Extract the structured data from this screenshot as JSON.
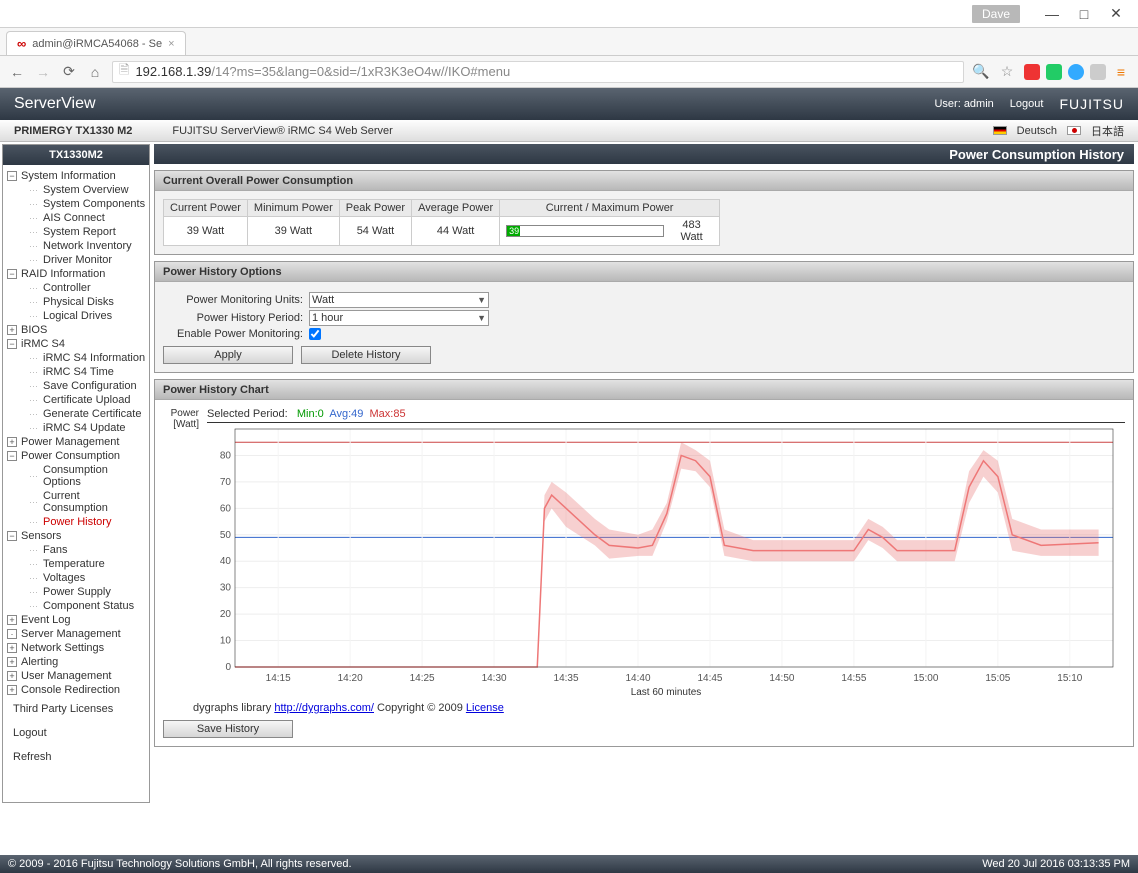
{
  "window": {
    "user_badge": "Dave"
  },
  "browser": {
    "tab_title": "admin@iRMCA54068 - Se",
    "url_host": "192.168.1.39",
    "url_path": "/14?ms=35&lang=0&sid=/1xR3K3eO4w//IKO#menu"
  },
  "header": {
    "title": "ServerView",
    "user_label": "User:",
    "user": "admin",
    "logout": "Logout",
    "logo": "FUJITSU"
  },
  "subheader": {
    "product": "PRIMERGY TX1330 M2",
    "server_line": "FUJITSU ServerView® iRMC S4 Web Server",
    "lang_de": "Deutsch",
    "lang_jp": "日本語"
  },
  "sidebar": {
    "host": "TX1330M2",
    "items": [
      {
        "label": "System Information",
        "top": true,
        "open": true
      },
      {
        "label": "System Overview",
        "child": true
      },
      {
        "label": "System Components",
        "child": true
      },
      {
        "label": "AIS Connect",
        "child": true
      },
      {
        "label": "System Report",
        "child": true
      },
      {
        "label": "Network Inventory",
        "child": true
      },
      {
        "label": "Driver Monitor",
        "child": true
      },
      {
        "label": "RAID Information",
        "top": true,
        "open": true
      },
      {
        "label": "Controller",
        "child": true
      },
      {
        "label": "Physical Disks",
        "child": true
      },
      {
        "label": "Logical Drives",
        "child": true
      },
      {
        "label": "BIOS",
        "top": true,
        "closed": true
      },
      {
        "label": "iRMC S4",
        "top": true,
        "open": true
      },
      {
        "label": "iRMC S4 Information",
        "child": true
      },
      {
        "label": "iRMC S4 Time",
        "child": true
      },
      {
        "label": "Save Configuration",
        "child": true
      },
      {
        "label": "Certificate Upload",
        "child": true
      },
      {
        "label": "Generate Certificate",
        "child": true
      },
      {
        "label": "iRMC S4 Update",
        "child": true
      },
      {
        "label": "Power Management",
        "top": true,
        "closed": true
      },
      {
        "label": "Power Consumption",
        "top": true,
        "open": true
      },
      {
        "label": "Consumption Options",
        "child": true
      },
      {
        "label": "Current Consumption",
        "child": true
      },
      {
        "label": "Power History",
        "child": true,
        "active": true
      },
      {
        "label": "Sensors",
        "top": true,
        "open": true
      },
      {
        "label": "Fans",
        "child": true
      },
      {
        "label": "Temperature",
        "child": true
      },
      {
        "label": "Voltages",
        "child": true
      },
      {
        "label": "Power Supply",
        "child": true
      },
      {
        "label": "Component Status",
        "child": true
      },
      {
        "label": "Event Log",
        "top": true,
        "closed": true
      },
      {
        "label": "Server Management",
        "top": true,
        "leaf": true
      },
      {
        "label": "Network Settings",
        "top": true,
        "closed": true
      },
      {
        "label": "Alerting",
        "top": true,
        "closed": true
      },
      {
        "label": "User Management",
        "top": true,
        "closed": true
      },
      {
        "label": "Console Redirection",
        "top": true,
        "closed": true
      }
    ],
    "footer": [
      "Third Party Licenses",
      "Logout",
      "Refresh"
    ]
  },
  "page": {
    "title": "Power Consumption History"
  },
  "panel1": {
    "title": "Current Overall Power Consumption",
    "cols": [
      "Current Power",
      "Minimum Power",
      "Peak Power",
      "Average Power",
      "Current / Maximum Power"
    ],
    "vals": [
      "39 Watt",
      "39 Watt",
      "54 Watt",
      "44 Watt"
    ],
    "bar_val": "39",
    "bar_max": "483 Watt"
  },
  "panel2": {
    "title": "Power History Options",
    "units_label": "Power Monitoring Units:",
    "units_val": "Watt",
    "period_label": "Power History Period:",
    "period_val": "1 hour",
    "enable_label": "Enable Power Monitoring:",
    "enable_checked": true,
    "apply": "Apply",
    "delete": "Delete History"
  },
  "panel3": {
    "title": "Power History Chart",
    "y_label": "Power [Watt]",
    "sel_period_label": "Selected Period:",
    "min": "Min:0",
    "avg": "Avg:49",
    "max": "Max:85",
    "x_label": "Last 60 minutes",
    "credits_pre": "dygraphs library ",
    "credits_link": "http://dygraphs.com/",
    "credits_mid": " Copyright © 2009 ",
    "credits_license": "License",
    "save": "Save History"
  },
  "chart_data": {
    "type": "line",
    "title": "Power [Watt]",
    "ylabel": "Power [Watt]",
    "xlabel": "Last 60 minutes",
    "ylim": [
      0,
      90
    ],
    "x_ticks": [
      "14:15",
      "14:20",
      "14:25",
      "14:30",
      "14:35",
      "14:40",
      "14:45",
      "14:50",
      "14:55",
      "15:00",
      "15:05",
      "15:10"
    ],
    "series": [
      {
        "name": "Power",
        "color": "#e77",
        "x": [
          "14:12",
          "14:33",
          "14:33.5",
          "14:34",
          "14:35",
          "14:37",
          "14:38",
          "14:40",
          "14:41",
          "14:42",
          "14:43",
          "14:44",
          "14:45",
          "14:46",
          "14:48",
          "14:55",
          "14:56",
          "14:57",
          "14:58",
          "15:02",
          "15:03",
          "15:04",
          "15:05",
          "15:06",
          "15:08",
          "15:12"
        ],
        "y": [
          0,
          0,
          60,
          65,
          60,
          50,
          46,
          45,
          46,
          58,
          80,
          78,
          72,
          46,
          44,
          44,
          52,
          49,
          44,
          44,
          68,
          78,
          72,
          50,
          46,
          47
        ],
        "band_low": [
          0,
          0,
          55,
          60,
          53,
          46,
          41,
          42,
          42,
          55,
          75,
          74,
          68,
          42,
          40,
          40,
          48,
          45,
          40,
          40,
          62,
          72,
          66,
          44,
          42,
          42
        ],
        "band_high": [
          0,
          0,
          65,
          70,
          66,
          56,
          52,
          50,
          52,
          62,
          85,
          82,
          78,
          52,
          48,
          48,
          56,
          53,
          48,
          48,
          74,
          82,
          78,
          56,
          52,
          52
        ]
      }
    ],
    "ref_lines": [
      {
        "name": "Avg",
        "value": 49,
        "color": "#36c"
      },
      {
        "name": "Max",
        "value": 85,
        "color": "#c44"
      }
    ]
  },
  "footer": {
    "copyright": "© 2009 - 2016 Fujitsu Technology Solutions GmbH, All rights reserved.",
    "timestamp": "Wed 20 Jul 2016 03:13:35 PM"
  }
}
